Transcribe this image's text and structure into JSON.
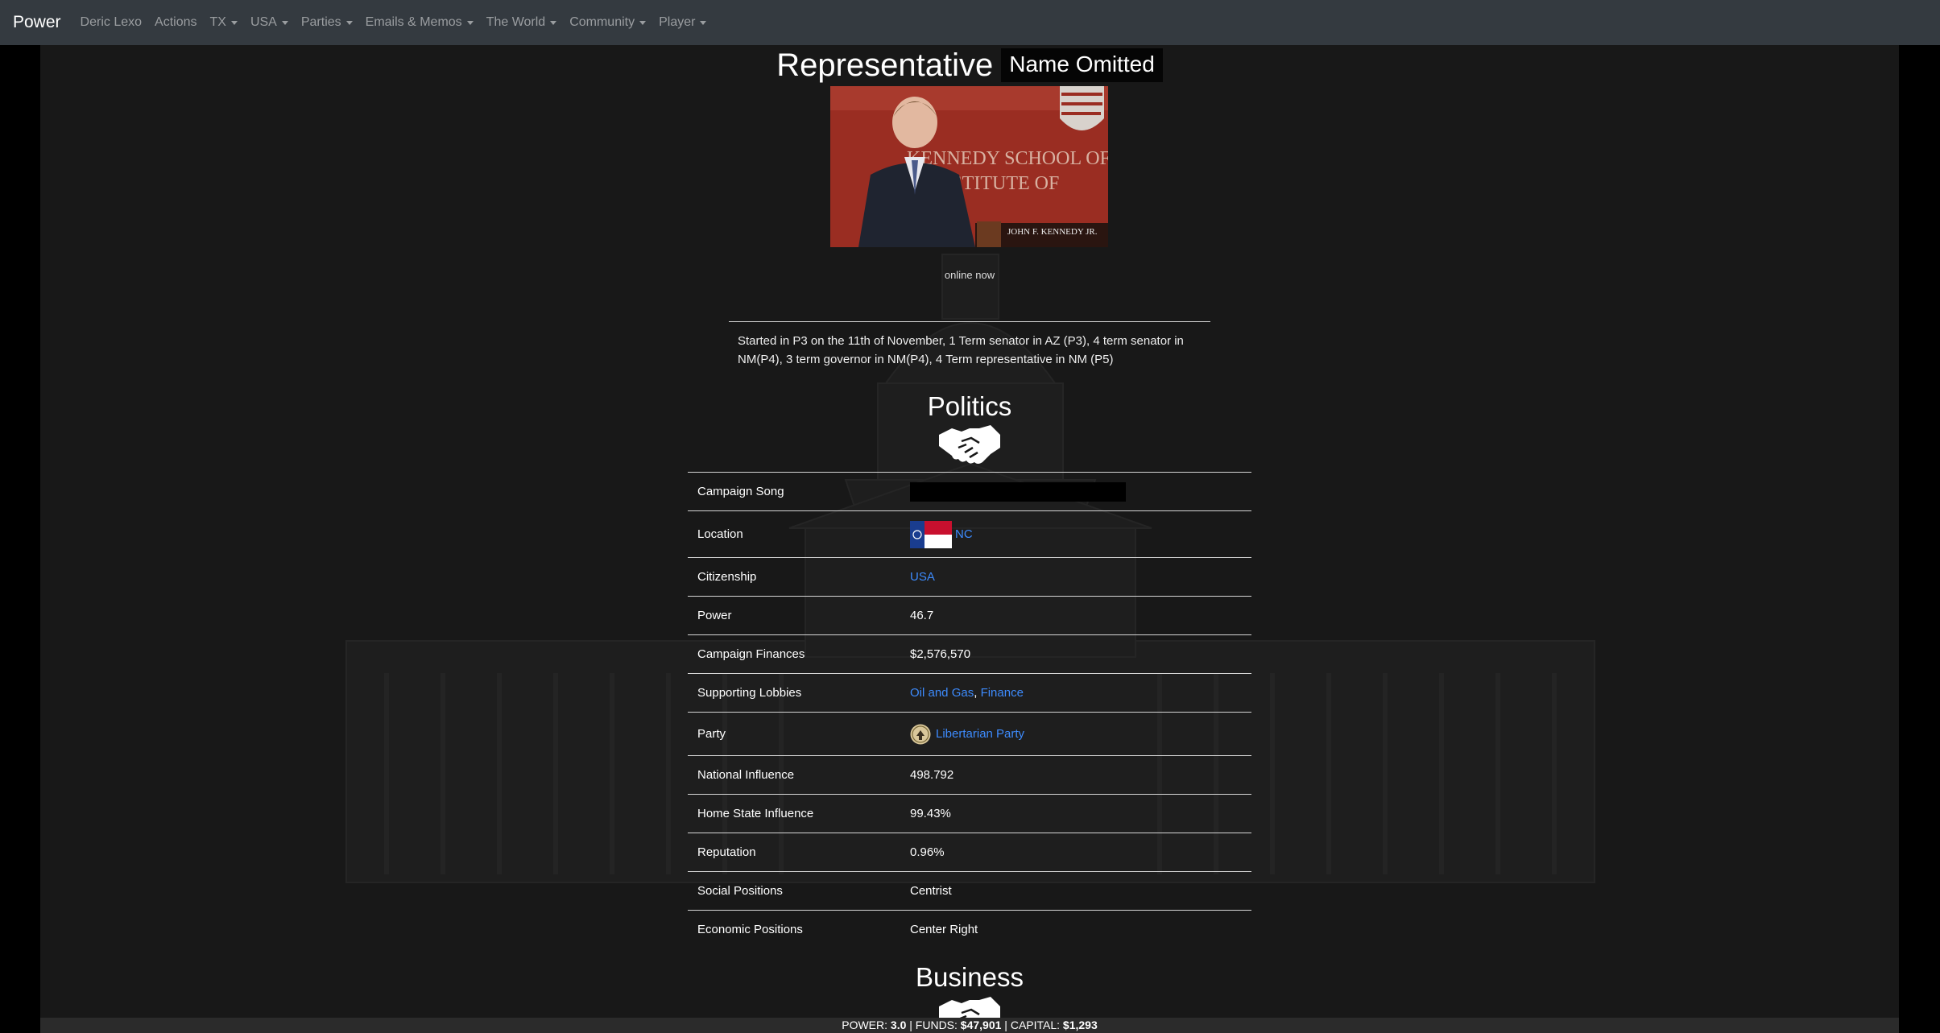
{
  "navbar": {
    "brand": "Power",
    "items": [
      {
        "label": "Deric Lexo",
        "dropdown": false
      },
      {
        "label": "Actions",
        "dropdown": false
      },
      {
        "label": "TX",
        "dropdown": true
      },
      {
        "label": "USA",
        "dropdown": true
      },
      {
        "label": "Parties",
        "dropdown": true
      },
      {
        "label": "Emails & Memos",
        "dropdown": true
      },
      {
        "label": "The World",
        "dropdown": true
      },
      {
        "label": "Community",
        "dropdown": true
      },
      {
        "label": "Player",
        "dropdown": true
      }
    ]
  },
  "profile": {
    "title": "Representative",
    "name": "Name Omitted",
    "photo_caption": "JOHN F. KENNEDY JR.",
    "photo_sign_line1": "KENNEDY SCHOOL OF",
    "photo_sign_line2": "INSTITUTE OF",
    "status": "online now",
    "bio": "Started in P3 on the 11th of November, 1 Term senator in AZ (P3), 4 term senator in NM(P4), 3 term governor in NM(P4), 4 Term representative in NM (P5)"
  },
  "politics": {
    "title": "Politics",
    "icon": "handshake-icon",
    "rows": {
      "campaign_song": {
        "label": "Campaign Song"
      },
      "location": {
        "label": "Location",
        "value": "NC"
      },
      "citizenship": {
        "label": "Citizenship",
        "value": "USA"
      },
      "power": {
        "label": "Power",
        "value": "46.7"
      },
      "campaign_finances": {
        "label": "Campaign Finances",
        "value": "$2,576,570"
      },
      "supporting_lobbies": {
        "label": "Supporting Lobbies",
        "lobby1": "Oil and Gas",
        "separator": ", ",
        "lobby2": "Finance"
      },
      "party": {
        "label": "Party",
        "value": "Libertarian Party"
      },
      "national_influence": {
        "label": "National Influence",
        "value": "498.792"
      },
      "home_state_influence": {
        "label": "Home State Influence",
        "value": "99.43%"
      },
      "reputation": {
        "label": "Reputation",
        "value": "0.96%"
      },
      "social_positions": {
        "label": "Social Positions",
        "value": "Centrist"
      },
      "economic_positions": {
        "label": "Economic Positions",
        "value": "Center Right"
      }
    }
  },
  "business": {
    "title": "Business",
    "icon": "handshake-icon"
  },
  "statusbar": {
    "power_label": "POWER: ",
    "power_value": "3.0",
    "sep1": " | ",
    "funds_label": "FUNDS: ",
    "funds_value": "$47,901",
    "sep2": " | ",
    "capital_label": "CAPITAL: ",
    "capital_value": "$1,293"
  },
  "colors": {
    "navbar": "#343a40",
    "link": "#3d8bfd",
    "panel": "#181818",
    "photo_bg": "#9a2d22"
  }
}
